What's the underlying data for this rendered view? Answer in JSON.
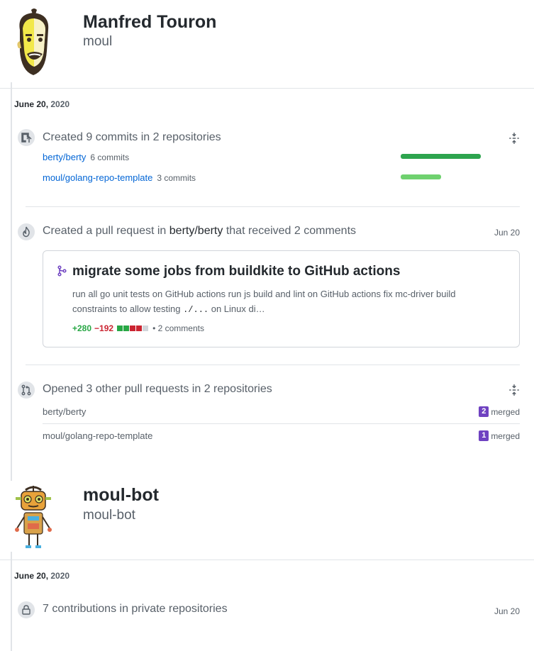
{
  "user1": {
    "name": "Manfred Touron",
    "login": "moul",
    "date_day": "June 20,",
    "date_year": "2020",
    "commits": {
      "title_prefix": "Created 9 commits in 2 repositories",
      "repos": [
        {
          "name": "berty/berty",
          "count": "6 commits",
          "fraction": 0.67
        },
        {
          "name": "moul/golang-repo-template",
          "count": "3 commits",
          "fraction": 0.33
        }
      ]
    },
    "pull_request": {
      "title_prefix": "Created a pull request in",
      "repo": "berty/berty",
      "title_suffix": "that received 2 comments",
      "date": "Jun 20",
      "pr_title": "migrate some jobs from buildkite to GitHub actions",
      "body_1": "run all go unit tests on GitHub actions run js build and lint on GitHub actions fix mc-driver build constraints to allow testing",
      "body_code": "./...",
      "body_2": "on Linux di…",
      "additions": "+280",
      "deletions": "−192",
      "comments": "• 2 comments"
    },
    "opened_prs": {
      "title": "Opened 3 other pull requests in 2 repositories",
      "rows": [
        {
          "repo": "berty/berty",
          "count": "2",
          "status": "merged"
        },
        {
          "repo": "moul/golang-repo-template",
          "count": "1",
          "status": "merged"
        }
      ]
    }
  },
  "user2": {
    "name": "moul-bot",
    "login": "moul-bot",
    "date_day": "June 20,",
    "date_year": "2020",
    "private": {
      "title": "7 contributions in private repositories",
      "date": "Jun 20"
    }
  },
  "colors": {
    "bar_dark": "#2da44e",
    "bar_light": "#6fd16f",
    "merged": "#6f42c1",
    "link": "#0366d6"
  }
}
